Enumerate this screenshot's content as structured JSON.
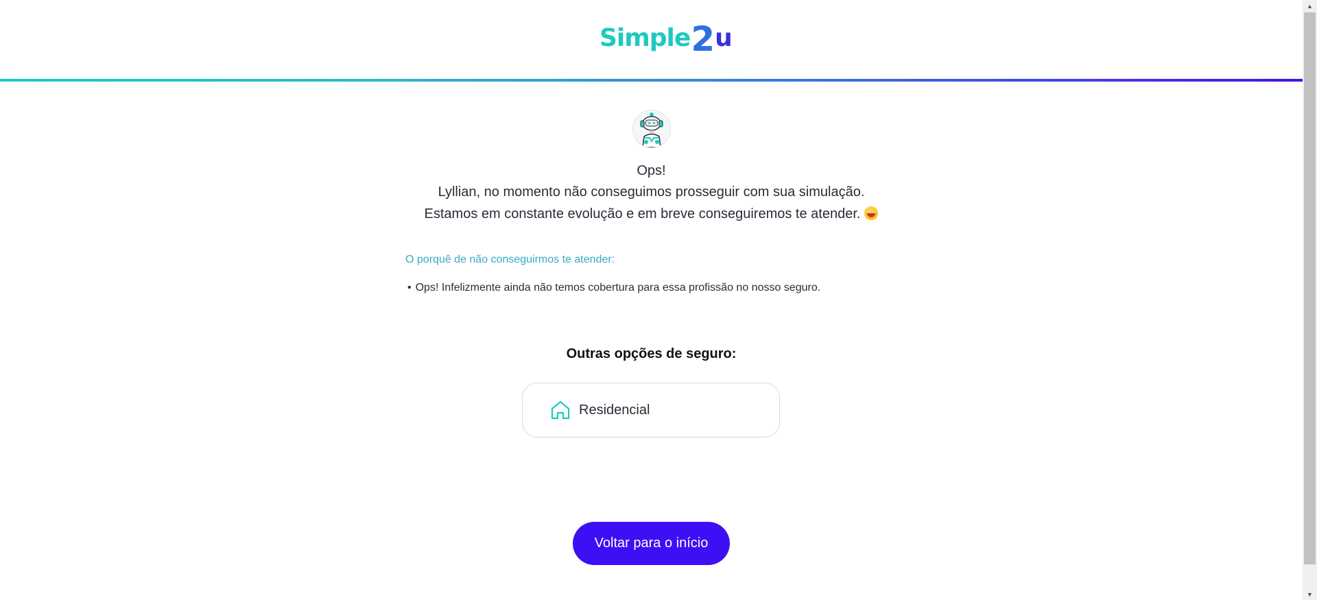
{
  "header": {
    "logo_part1": "Simple",
    "logo_part2": "2",
    "logo_part3": "u"
  },
  "message": {
    "line1": "Ops!",
    "line2": "Lyllian, no momento não conseguimos prosseguir com sua simulação.",
    "line3": "Estamos em constante evolução e em breve conseguiremos te atender."
  },
  "reasons": {
    "title": "O porquê de não conseguirmos te atender:",
    "items": [
      "Ops! Infelizmente ainda não temos cobertura para essa profissão no nosso seguro."
    ]
  },
  "other_options": {
    "title": "Outras opções de seguro:",
    "items": [
      {
        "label": "Residencial",
        "icon": "house-icon"
      }
    ]
  },
  "actions": {
    "back_label": "Voltar para o início"
  },
  "colors": {
    "teal": "#1ec9bf",
    "purple": "#3d0ff5",
    "link_blue": "#3aa8c5"
  }
}
